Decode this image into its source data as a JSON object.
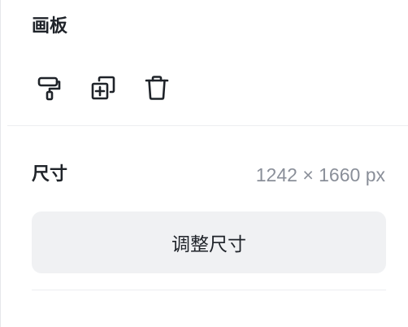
{
  "artboard": {
    "title": "画板",
    "tools": [
      {
        "icon": "paint-roller-icon"
      },
      {
        "icon": "duplicate-icon"
      },
      {
        "icon": "trash-icon"
      }
    ]
  },
  "size": {
    "title": "尺寸",
    "value": "1242 × 1660 px",
    "resize_label": "调整尺寸"
  }
}
